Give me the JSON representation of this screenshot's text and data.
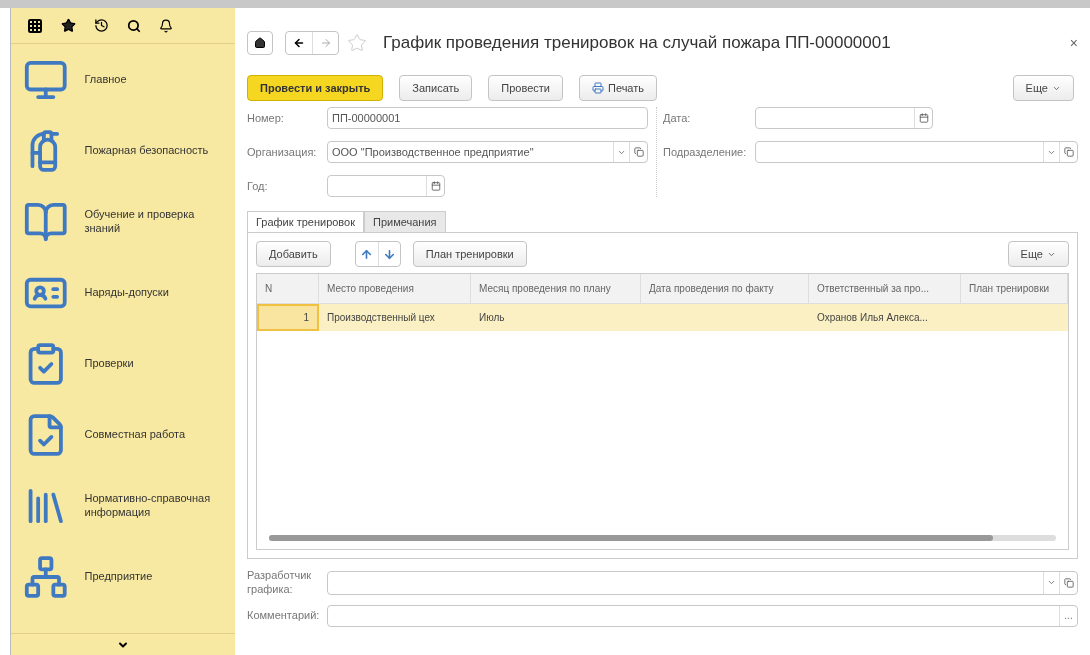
{
  "sidebar": {
    "items": [
      {
        "label": "Главное"
      },
      {
        "label": "Пожарная безопасность"
      },
      {
        "label": "Обучение и проверка знаний"
      },
      {
        "label": "Наряды-допуски"
      },
      {
        "label": "Проверки"
      },
      {
        "label": "Совместная работа"
      },
      {
        "label": "Нормативно-справочная информация"
      },
      {
        "label": "Предприятие"
      }
    ]
  },
  "title": "График проведения тренировок на случай пожара ПП-00000001",
  "close": "×",
  "toolbar": {
    "buttons": [
      {
        "label": "Провести и закрыть",
        "kind": "primary"
      },
      {
        "label": "Записать",
        "kind": "plain"
      },
      {
        "label": "Провести",
        "kind": "plain"
      },
      {
        "label": "Печать",
        "kind": "print"
      }
    ],
    "more": "Еще"
  },
  "fields": {
    "number": {
      "label": "Номер:",
      "value": "ПП-00000001"
    },
    "date": {
      "label": "Дата:"
    },
    "organization": {
      "label": "Организация:",
      "value": "ООО \"Производственное предприятие\""
    },
    "department": {
      "label": "Подразделение:"
    },
    "year": {
      "label": "Год:"
    }
  },
  "tabs": [
    {
      "label": "График тренировок",
      "selected": true
    },
    {
      "label": "Примечания",
      "selected": false
    }
  ],
  "table_toolbar": {
    "add": "Добавить",
    "plan": "План тренировки",
    "more": "Еще"
  },
  "table": {
    "columns": [
      "N",
      "Место проведения",
      "Месяц проведения по плану",
      "Дата проведения по факту",
      "Ответственный за про...",
      "План тренировки"
    ],
    "rows": [
      {
        "n": "1",
        "place": "Производственный цех",
        "month": "Июль",
        "responsible": "Охранов Илья Алекса...",
        "selected": true
      }
    ]
  },
  "developer": {
    "label": "Разработчик графика:"
  },
  "comment": {
    "label": "Комментарий:",
    "button": "..."
  }
}
